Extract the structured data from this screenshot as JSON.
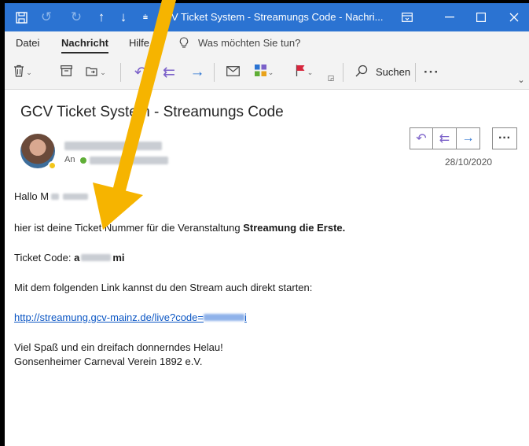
{
  "window": {
    "title": "V Ticket System - Streamungs Code  -  Nachri..."
  },
  "menu": {
    "items": [
      {
        "label": "Datei"
      },
      {
        "label": "Nachricht"
      },
      {
        "label": "Hilfe"
      }
    ],
    "tell_me": "Was möchten Sie tun?"
  },
  "ribbon": {
    "search_label": "Suchen",
    "more_label": "···"
  },
  "email": {
    "subject": "GCV Ticket System - Streamungs Code",
    "to_label": "An",
    "date": "28/10/2020",
    "greeting": "Hallo M",
    "intro_text": "hier ist deine Ticket Nummer für die Veranstaltung ",
    "event_name": "Streamung die Erste.",
    "ticket_code_label": "Ticket Code: ",
    "ticket_code_start": "a",
    "ticket_code_end": "mi",
    "link_intro": "Mit dem folgenden Link kannst du den Stream auch direkt starten:",
    "link_text": "http://streamung.gcv-mainz.de/live?code=",
    "link_end": "i",
    "closing": "Viel Spaß und ein dreifach donnerndes Helau!",
    "signature": "Gonsenheimer Carneval Verein 1892 e.V."
  },
  "colors": {
    "titlebar": "#2b73d2",
    "link": "#0b56c4",
    "arrow": "#f6b400"
  }
}
